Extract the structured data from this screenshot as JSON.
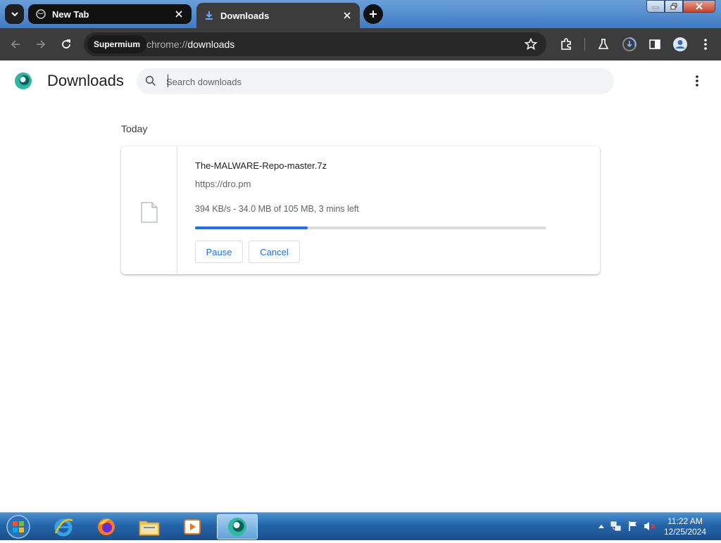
{
  "tabs": [
    {
      "title": "New Tab",
      "icon": "globe-icon"
    },
    {
      "title": "Downloads",
      "icon": "download-icon"
    }
  ],
  "omnibox": {
    "chip": "Supermium",
    "url_scheme": "chrome://",
    "url_path": "downloads"
  },
  "page": {
    "title": "Downloads"
  },
  "search": {
    "placeholder": "Search downloads",
    "value": ""
  },
  "section_label": "Today",
  "download": {
    "filename": "The-MALWARE-Repo-master.7z",
    "url": "https://dro.pm",
    "status": "394 KB/s - 34.0 MB of 105 MB, 3 mins left",
    "progress_percent": 32,
    "pause_label": "Pause",
    "cancel_label": "Cancel"
  },
  "colors": {
    "accent": "#1a73e8",
    "toolbar": "#3c3c3c",
    "tabstrip_bg": "#2b2b2b"
  },
  "taskbar": {
    "apps": [
      "internet-explorer-icon",
      "firefox-icon",
      "file-explorer-icon",
      "media-player-icon",
      "supermium-icon"
    ],
    "time": "11:22 AM",
    "date": "12/25/2024"
  }
}
